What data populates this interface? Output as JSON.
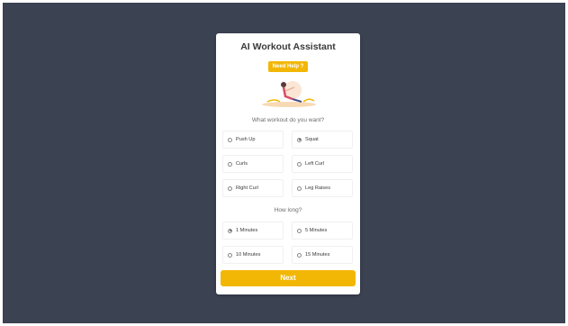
{
  "title": "AI Workout Assistant",
  "help_button": "Need Help ?",
  "workout_question": "What workout do you want?",
  "workouts": [
    {
      "label": "Push Up",
      "checked": false
    },
    {
      "label": "Squat",
      "checked": true
    },
    {
      "label": "Curls",
      "checked": false
    },
    {
      "label": "Left Curl",
      "checked": false
    },
    {
      "label": "Right Curl",
      "checked": false
    },
    {
      "label": "Leg Raises",
      "checked": false
    }
  ],
  "duration_question": "How long?",
  "durations": [
    {
      "label": "1 Minutes",
      "checked": true
    },
    {
      "label": "5 Minutes",
      "checked": false
    },
    {
      "label": "10 Minutes",
      "checked": false
    },
    {
      "label": "15 Minutes",
      "checked": false
    }
  ],
  "next_button": "Next",
  "colors": {
    "accent": "#f2b705",
    "background": "#3b4252",
    "card": "#ffffff"
  }
}
